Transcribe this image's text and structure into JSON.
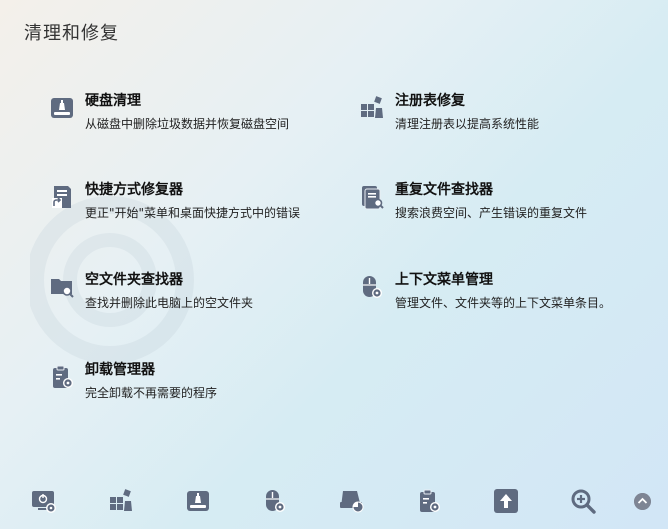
{
  "page": {
    "title": "清理和修复"
  },
  "tools": [
    {
      "name": "硬盘清理",
      "desc": "从磁盘中删除垃圾数据并恢复磁盘空间",
      "icon": "disk-clean-icon"
    },
    {
      "name": "注册表修复",
      "desc": "清理注册表以提高系统性能",
      "icon": "registry-repair-icon"
    },
    {
      "name": "快捷方式修复器",
      "desc": "更正\"开始\"菜单和桌面快捷方式中的错误",
      "icon": "shortcut-repair-icon"
    },
    {
      "name": "重复文件查找器",
      "desc": "搜索浪费空间、产生错误的重复文件",
      "icon": "duplicate-finder-icon"
    },
    {
      "name": "空文件夹查找器",
      "desc": "查找并删除此电脑上的空文件夹",
      "icon": "empty-folder-finder-icon"
    },
    {
      "name": "上下文菜单管理",
      "desc": "管理文件、文件夹等的上下文菜单条目。",
      "icon": "context-menu-icon"
    },
    {
      "name": "卸载管理器",
      "desc": "完全卸载不再需要的程序",
      "icon": "uninstall-manager-icon"
    }
  ],
  "bottom_bar": {
    "icons": [
      "startup-manager-icon",
      "registry-icon",
      "disk-clean-icon",
      "mouse-settings-icon",
      "disk-usage-icon",
      "uninstall-icon",
      "upload-icon",
      "search-zoom-icon",
      "scroll-up-icon"
    ]
  },
  "colors": {
    "icon": "#5f6b80",
    "accent": "#3c4a60"
  }
}
